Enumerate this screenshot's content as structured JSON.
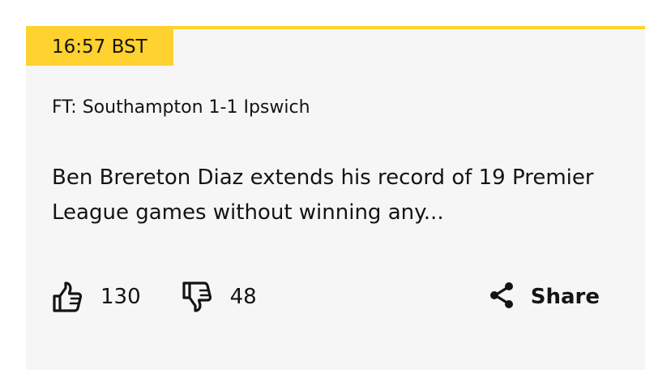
{
  "post": {
    "timestamp": "16:57 BST",
    "headline": "FT: Southampton 1-1 Ipswich",
    "summary": "Ben Brereton Diaz extends his record of 19 Premier League games without winning any..."
  },
  "reactions": {
    "like_icon": "thumbs-up-icon",
    "like_count": "130",
    "dislike_icon": "thumbs-down-icon",
    "dislike_count": "48"
  },
  "share": {
    "icon": "share-icon",
    "label": "Share"
  },
  "colors": {
    "accent": "#ffd230",
    "card_background": "#f6f6f6",
    "text": "#141414"
  }
}
